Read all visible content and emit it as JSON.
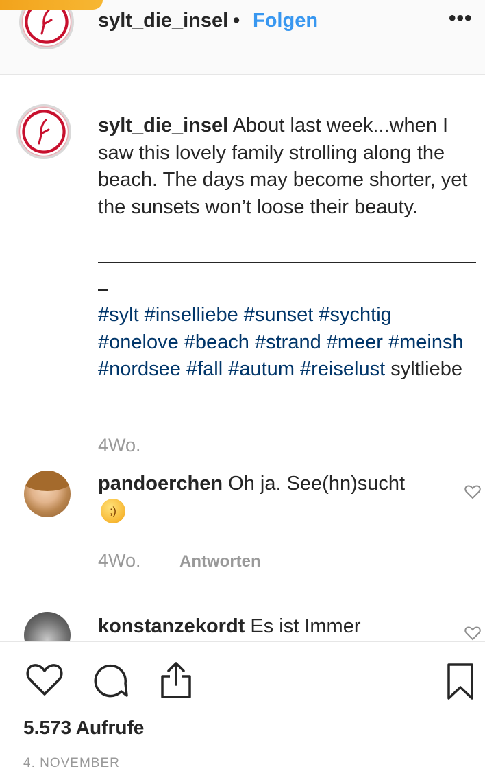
{
  "header": {
    "username": "sylt_die_insel",
    "separator": "•",
    "follow_label": "Folgen",
    "more_icon": "more-horizontal-icon",
    "more_label": "•••"
  },
  "caption": {
    "username": "sylt_die_insel",
    "text": "About last week...when I saw this lovely family strolling along the beach. The days may become shorter, yet the sunsets won’t loose their beauty.",
    "divider": "________________________________",
    "hashtags": "#sylt #inselliebe #sunset #sychtig #onelove #beach #strand #meer #meinsh #nordsee #fall #autum #reiselust",
    "extra_tag": "syltliebe",
    "time": "4Wo."
  },
  "comments": [
    {
      "username": "pandoerchen",
      "text": "Oh ja. See(hn)sucht",
      "emoji": "wink-emoji",
      "time": "4Wo.",
      "reply_label": "Antworten"
    },
    {
      "username": "konstanzekordt",
      "text": "Es ist Immer"
    }
  ],
  "actions": {
    "like_icon": "heart-icon",
    "comment_icon": "comment-icon",
    "share_icon": "share-icon",
    "save_icon": "bookmark-icon"
  },
  "stats": {
    "views": "5.573 Aufrufe",
    "date": "4. NOVEMBER"
  },
  "colors": {
    "link_blue": "#3897f0",
    "hashtag": "#003569",
    "muted": "#999999",
    "text": "#262626",
    "brand_red": "#c8102e"
  }
}
